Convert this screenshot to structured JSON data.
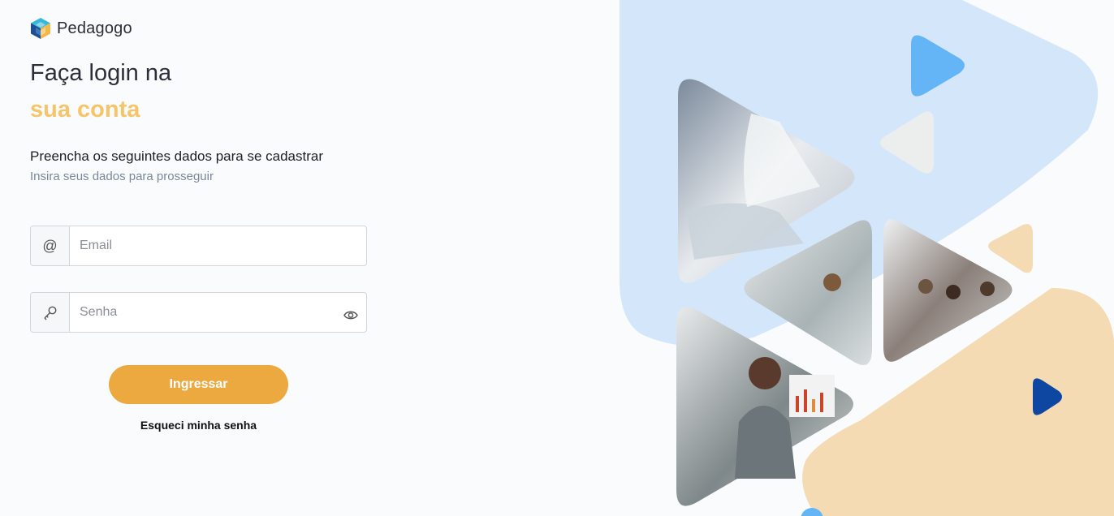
{
  "brand": {
    "name": "Pedagogo",
    "logo_icon": "cube-logo-icon"
  },
  "heading": {
    "line1": "Faça login na",
    "line2": "sua conta"
  },
  "subtitle": "Preencha os seguintes dados para se cadastrar",
  "hint": "Insira seus dados para prosseguir",
  "form": {
    "email": {
      "icon_symbol": "@",
      "placeholder": "Email",
      "value": ""
    },
    "password": {
      "placeholder": "Senha",
      "value": "",
      "icon": "key-icon",
      "toggle_icon": "eye-icon"
    },
    "submit_label": "Ingressar",
    "forgot_label": "Esqueci minha senha"
  },
  "colors": {
    "accent": "#eba93f",
    "highlight_text": "#f6c56a",
    "blue_shape": "#d4e6fa",
    "peach_shape": "#f4dbb3",
    "play_blue": "#64b5f6",
    "play_navy": "#0d47a1"
  }
}
